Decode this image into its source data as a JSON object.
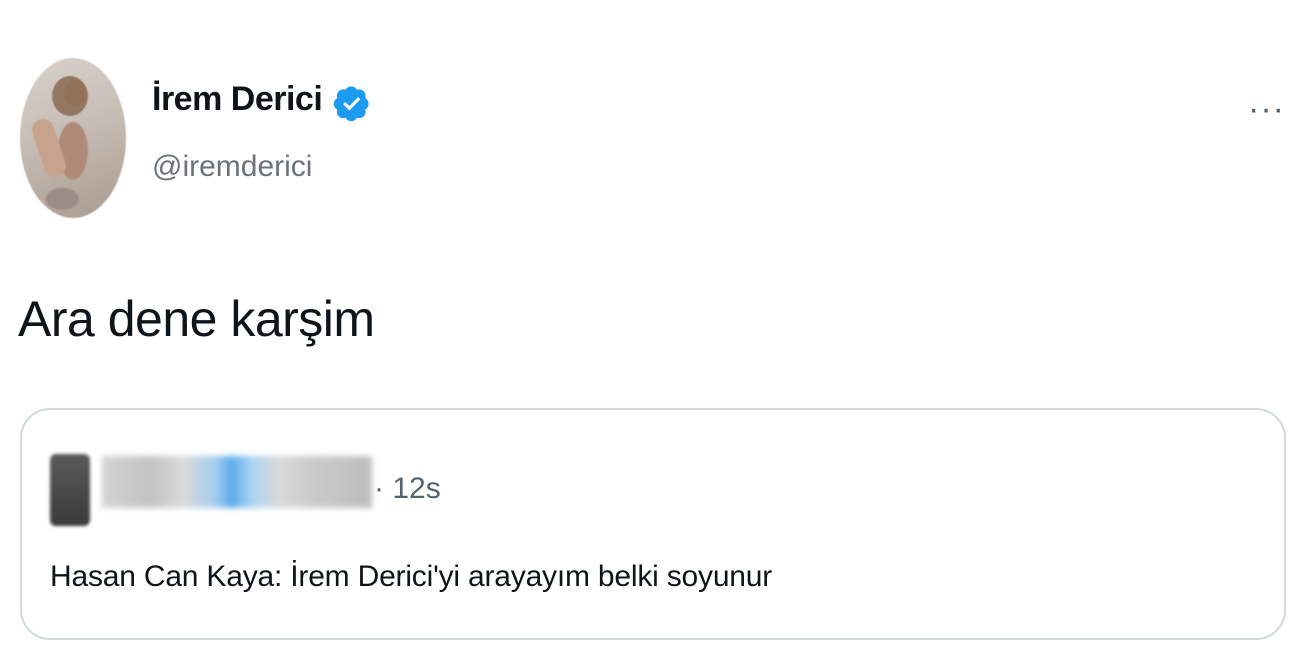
{
  "tweet": {
    "author": {
      "display_name": "İrem Derici",
      "handle": "@iremderici",
      "verified": true
    },
    "more_icon": "···",
    "text": "Ara dene karşim",
    "quoted": {
      "time": "· 12s",
      "text": "Hasan Can Kaya: İrem Derici'yi arayayım belki soyunur"
    }
  },
  "colors": {
    "verified_badge": "#1d9bf0",
    "secondary_text": "#536471",
    "border": "#cfd9de"
  },
  "icons": [
    "verified-badge-icon",
    "more-options-icon"
  ]
}
